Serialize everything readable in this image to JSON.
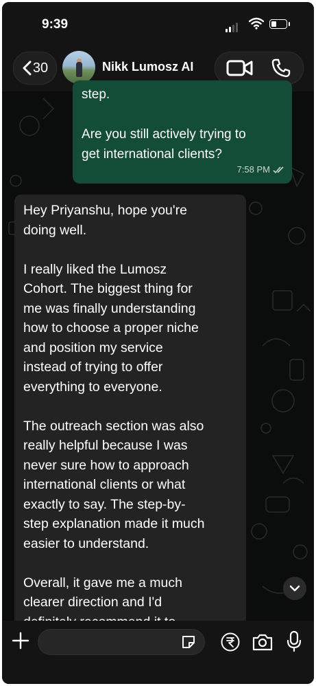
{
  "status_bar": {
    "time": "9:39"
  },
  "header": {
    "back_count": "30",
    "contact_name": "Nikk Lumosz AI"
  },
  "messages": {
    "outgoing": {
      "text": "step.\n\nAre you still actively trying to\nget international clients?",
      "time": "7:58 PM"
    },
    "incoming": {
      "text": "Hey Priyanshu, hope you're\ndoing well.\n\nI really liked the Lumosz\nCohort. The biggest thing for\nme was finally understanding\nhow to choose a proper niche\nand position my service\ninstead of trying to offer\neverything to everyone.\n\nThe outreach section was also\nreally helpful because I was\nnever sure how to approach\ninternational clients or what\nexactly to say. The step-by-\nstep explanation made it much\neasier to understand.\n\nOverall, it gave me a much\nclearer direction and I'd\ndefinitely recommend it to"
    }
  },
  "composer": {
    "placeholder": ""
  },
  "colors": {
    "outgoing_bubble": "#144d37",
    "incoming_bubble": "#232323",
    "background": "#0b0c0c"
  },
  "icons": {
    "back": "chevron-left-icon",
    "video": "video-camera-icon",
    "call": "phone-icon",
    "read_receipt": "double-check-icon",
    "scroll_down": "chevron-down-icon",
    "attach": "plus-icon",
    "sticker": "sticker-icon",
    "payment": "rupee-icon",
    "camera": "camera-icon",
    "mic": "microphone-icon"
  }
}
